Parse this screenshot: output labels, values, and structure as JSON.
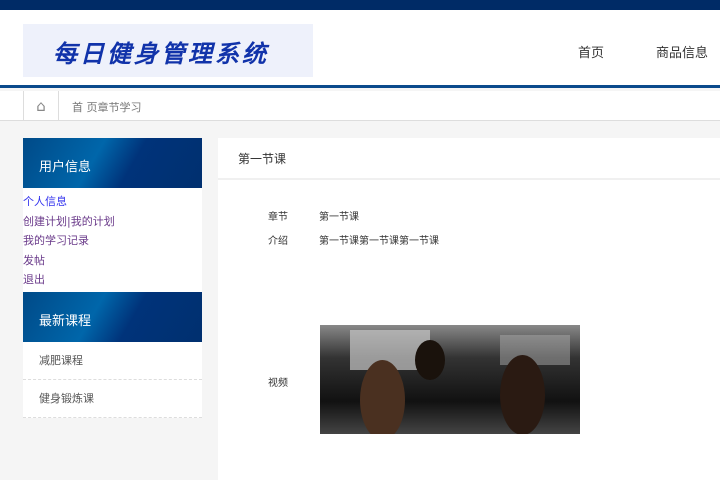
{
  "header": {
    "logo": "每日健身管理系统",
    "nav": [
      "首页",
      "商品信息"
    ]
  },
  "breadcrumb": {
    "text": "首 页章节学习"
  },
  "sidebar": {
    "user_title": "用户信息",
    "user_links": [
      "个人信息",
      "创建计划|我的计划",
      "我的学习记录",
      "发帖",
      "退出"
    ],
    "course_title": "最新课程",
    "courses": [
      "减肥课程",
      "健身锻炼课"
    ]
  },
  "main": {
    "title": "第一节课",
    "fields": [
      {
        "label": "章节",
        "value": "第一节课"
      },
      {
        "label": "介绍",
        "value": "第一节课第一节课第一节课"
      },
      {
        "label": "视频",
        "value": ""
      }
    ]
  },
  "colors": {
    "primary": "#002b66",
    "link": "#3333ee",
    "visited": "#6a3a8a"
  }
}
